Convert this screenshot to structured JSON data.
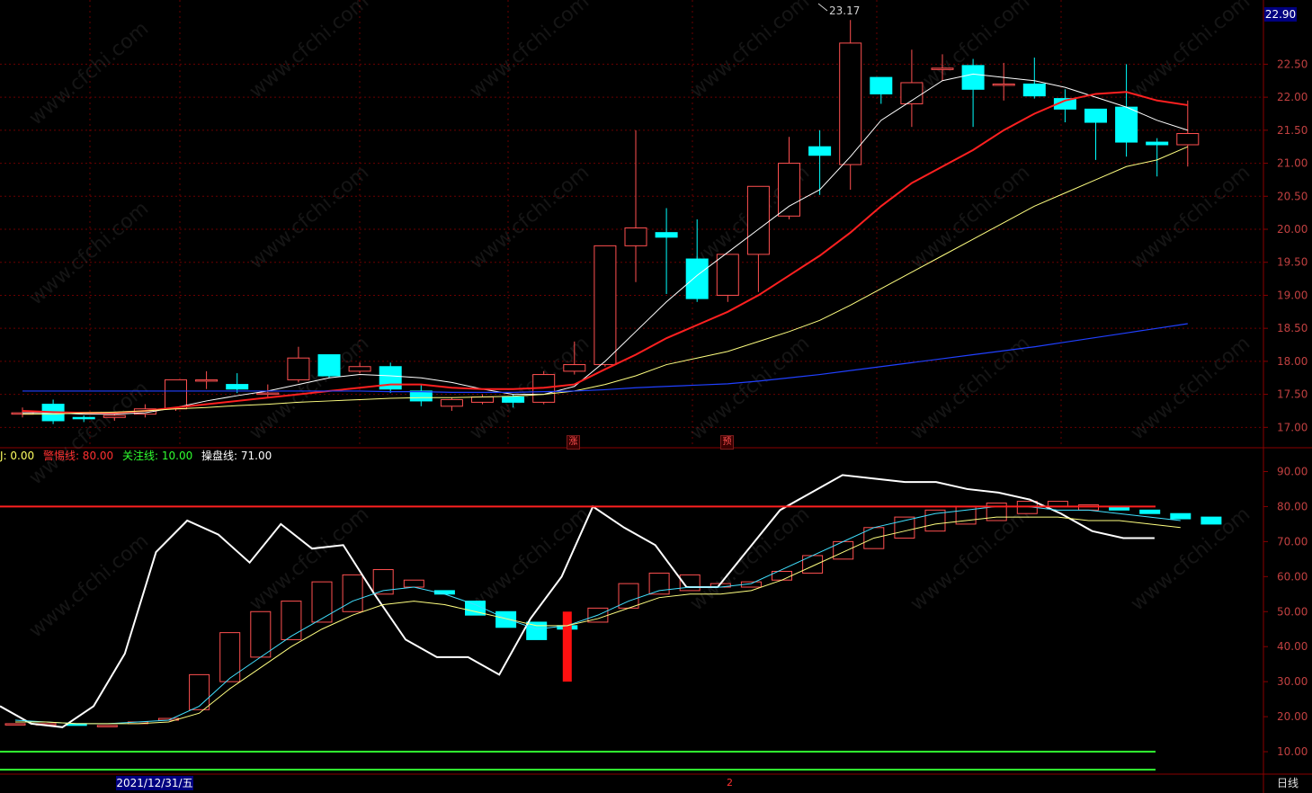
{
  "app": {
    "period_label": "日线",
    "cursor_date": "2021/12/31/五",
    "x_axis_marker": "2",
    "current_price": "22.90",
    "high_marker": "23.17",
    "watermark": "www.cfchi.com",
    "colors": {
      "background": "#000000",
      "up": "#ff5050",
      "down": "#00ffff",
      "ma5": "#ffffff",
      "ma10": "#ff2020",
      "ma20": "#ffff80",
      "ma60": "#2040ff",
      "grid": "#6a0000"
    }
  },
  "price_panel": {
    "y_ticks": [
      "22.50",
      "22.00",
      "21.50",
      "21.00",
      "20.50",
      "20.00",
      "19.50",
      "19.00",
      "18.50",
      "18.00",
      "17.50",
      "17.00"
    ],
    "tags": [
      {
        "text": "涨"
      },
      {
        "text": "预"
      }
    ]
  },
  "indicator_panel": {
    "legend": [
      {
        "label": "J: 0.00",
        "color": "#ffffff"
      },
      {
        "label": "警惕线: 80.00",
        "color": "#ff3030"
      },
      {
        "label": "关注线: 10.00",
        "color": "#30ff30"
      },
      {
        "label": "操盘线: 71.00",
        "color": "#ffffff"
      }
    ],
    "y_ticks": [
      "90.00",
      "80.00",
      "70.00",
      "60.00",
      "50.00",
      "40.00",
      "30.00",
      "20.00",
      "10.00"
    ]
  },
  "chart_data": [
    {
      "type": "candlestick",
      "ylim": [
        16.8,
        23.2
      ],
      "candles": [
        [
          17.22,
          17.22,
          17.3,
          17.15
        ],
        [
          17.35,
          17.1,
          17.42,
          17.05
        ],
        [
          17.15,
          17.13,
          17.18,
          17.08
        ],
        [
          17.15,
          17.18,
          17.22,
          17.1
        ],
        [
          17.2,
          17.28,
          17.35,
          17.15
        ],
        [
          17.28,
          17.72,
          17.72,
          17.25
        ],
        [
          17.72,
          17.72,
          17.85,
          17.58
        ],
        [
          17.65,
          17.58,
          17.82,
          17.52
        ],
        [
          17.52,
          17.52,
          17.65,
          17.45
        ],
        [
          17.72,
          18.05,
          18.22,
          17.68
        ],
        [
          18.1,
          17.78,
          18.1,
          17.75
        ],
        [
          17.85,
          17.92,
          17.98,
          17.82
        ],
        [
          17.92,
          17.58,
          17.98,
          17.52
        ],
        [
          17.55,
          17.4,
          17.65,
          17.32
        ],
        [
          17.32,
          17.42,
          17.45,
          17.25
        ],
        [
          17.38,
          17.46,
          17.5,
          17.35
        ],
        [
          17.46,
          17.38,
          17.5,
          17.3
        ],
        [
          17.38,
          17.8,
          17.85,
          17.35
        ],
        [
          17.85,
          17.95,
          18.3,
          17.8
        ],
        [
          17.95,
          19.75,
          19.75,
          17.92
        ],
        [
          19.75,
          20.02,
          21.5,
          19.2
        ],
        [
          19.95,
          19.88,
          20.32,
          19.02
        ],
        [
          19.55,
          18.95,
          20.15,
          18.9
        ],
        [
          19.0,
          19.62,
          19.62,
          18.9
        ],
        [
          19.62,
          20.65,
          20.65,
          19.05
        ],
        [
          20.2,
          21.0,
          21.4,
          20.15
        ],
        [
          21.25,
          21.12,
          21.5,
          20.52
        ],
        [
          20.98,
          22.82,
          23.17,
          20.6
        ],
        [
          22.3,
          22.05,
          22.3,
          21.9
        ],
        [
          21.9,
          22.22,
          22.72,
          21.55
        ],
        [
          22.42,
          22.44,
          22.65,
          22.25
        ],
        [
          22.48,
          22.12,
          22.58,
          21.55
        ],
        [
          22.18,
          22.2,
          22.52,
          21.95
        ],
        [
          22.2,
          22.02,
          22.6,
          21.98
        ],
        [
          21.98,
          21.82,
          22.12,
          21.62
        ],
        [
          21.82,
          21.62,
          21.75,
          21.05
        ],
        [
          21.85,
          21.32,
          22.5,
          21.1
        ],
        [
          21.32,
          21.28,
          21.38,
          20.8
        ],
        [
          21.28,
          21.45,
          21.95,
          20.95
        ]
      ],
      "series": [
        {
          "key": "ma5",
          "values": [
            17.22,
            17.22,
            17.2,
            17.2,
            17.22,
            17.3,
            17.4,
            17.48,
            17.55,
            17.65,
            17.75,
            17.8,
            17.78,
            17.75,
            17.68,
            17.58,
            17.5,
            17.5,
            17.62,
            18.0,
            18.45,
            18.9,
            19.3,
            19.65,
            20.0,
            20.35,
            20.6,
            21.1,
            21.65,
            21.95,
            22.25,
            22.35,
            22.3,
            22.25,
            22.15,
            22.0,
            21.85,
            21.65,
            21.5
          ]
        },
        {
          "key": "ma10",
          "values": [
            17.25,
            17.23,
            17.22,
            17.22,
            17.25,
            17.3,
            17.35,
            17.4,
            17.45,
            17.5,
            17.55,
            17.6,
            17.65,
            17.65,
            17.6,
            17.58,
            17.58,
            17.6,
            17.65,
            17.88,
            18.1,
            18.35,
            18.55,
            18.75,
            19.0,
            19.3,
            19.6,
            19.95,
            20.35,
            20.7,
            20.95,
            21.2,
            21.5,
            21.75,
            21.95,
            22.05,
            22.08,
            21.95,
            21.88
          ]
        },
        {
          "key": "ma20",
          "values": [
            17.2,
            17.2,
            17.22,
            17.23,
            17.25,
            17.28,
            17.3,
            17.33,
            17.35,
            17.38,
            17.4,
            17.42,
            17.44,
            17.45,
            17.45,
            17.46,
            17.47,
            17.5,
            17.55,
            17.65,
            17.78,
            17.95,
            18.05,
            18.15,
            18.3,
            18.45,
            18.62,
            18.85,
            19.1,
            19.35,
            19.6,
            19.85,
            20.1,
            20.35,
            20.55,
            20.75,
            20.95,
            21.05,
            21.25
          ]
        },
        {
          "key": "ma60",
          "values": [
            17.55,
            17.55,
            17.55,
            17.55,
            17.55,
            17.55,
            17.55,
            17.55,
            17.55,
            17.55,
            17.55,
            17.55,
            17.54,
            17.54,
            17.53,
            17.53,
            17.53,
            17.54,
            17.55,
            17.57,
            17.6,
            17.62,
            17.64,
            17.66,
            17.7,
            17.75,
            17.8,
            17.86,
            17.92,
            17.98,
            18.04,
            18.1,
            18.16,
            18.22,
            18.29,
            18.36,
            18.43,
            18.5,
            18.57
          ]
        }
      ]
    },
    {
      "type": "candlestick",
      "ylim": [
        0,
        95
      ],
      "candles": [
        [
          18,
          18,
          18.5,
          17.5
        ],
        [
          18,
          18,
          18.5,
          17.5
        ],
        [
          18,
          17.5,
          18.5,
          17
        ],
        [
          17.5,
          17.5,
          18,
          17
        ],
        [
          18,
          18.5,
          19,
          17.5
        ],
        [
          19,
          19.5,
          20,
          18.5
        ],
        [
          22,
          32,
          32.5,
          21.5
        ],
        [
          30,
          44,
          44.5,
          29.5
        ],
        [
          37,
          50,
          50.5,
          36.5
        ],
        [
          42,
          53,
          53.5,
          41.5
        ],
        [
          47,
          58.5,
          59,
          46.5
        ],
        [
          50,
          60.5,
          61,
          49.5
        ],
        [
          55,
          62,
          62.5,
          54.5
        ],
        [
          57,
          59,
          59.5,
          56.5
        ],
        [
          56,
          55,
          56,
          54.5
        ],
        [
          53,
          49,
          53,
          48.5
        ],
        [
          50,
          45.5,
          50,
          45
        ],
        [
          47,
          42,
          47,
          41.5
        ],
        [
          46,
          45,
          46,
          44.5
        ],
        [
          47,
          51,
          51.5,
          46.5
        ],
        [
          51,
          58,
          58.5,
          50.5
        ],
        [
          55,
          61,
          61.5,
          54.5
        ],
        [
          56,
          60.5,
          61,
          55.5
        ],
        [
          57,
          58,
          58.5,
          56.5
        ],
        [
          57,
          58.5,
          59,
          56.5
        ],
        [
          59,
          61.5,
          62,
          58.5
        ],
        [
          61,
          66,
          66.5,
          60.5
        ],
        [
          65,
          70,
          70.5,
          64.5
        ],
        [
          68,
          74,
          74.5,
          67.5
        ],
        [
          71,
          77,
          77.5,
          70.5
        ],
        [
          73,
          79,
          79.5,
          72.5
        ],
        [
          75,
          80,
          80.5,
          74.5
        ],
        [
          76,
          81,
          81.5,
          75.5
        ],
        [
          78,
          81.5,
          82,
          77.5
        ],
        [
          80,
          81.5,
          82,
          79.5
        ],
        [
          79,
          80.5,
          81,
          78.5
        ],
        [
          80,
          79,
          80,
          78.5
        ],
        [
          79,
          78,
          79,
          77.5
        ],
        [
          78,
          76.5,
          78,
          76
        ],
        [
          77,
          75,
          77,
          74.5
        ]
      ],
      "series": [
        {
          "key": "cao_pan_xian",
          "values": [
            23,
            18,
            17,
            23,
            38,
            67,
            76,
            72,
            64,
            75,
            68,
            69,
            55,
            42,
            37,
            37,
            32,
            48,
            60,
            80,
            74,
            69,
            57,
            57,
            68,
            79,
            84,
            89,
            88,
            87,
            87,
            85,
            84,
            82,
            78,
            73,
            71,
            71
          ]
        },
        {
          "key": "k_line",
          "values": [
            19,
            18.5,
            18,
            18,
            18.5,
            19,
            23,
            31,
            37,
            43,
            48,
            53,
            56,
            57,
            55,
            52,
            48,
            45,
            46,
            49,
            53,
            56,
            57,
            57,
            58,
            62,
            66,
            70,
            74,
            76,
            78,
            79,
            80,
            80,
            79,
            79,
            78,
            77,
            76
          ]
        },
        {
          "key": "d_line",
          "values": [
            18.5,
            18.5,
            18,
            18,
            18,
            18.5,
            21,
            28,
            34,
            40,
            45,
            49,
            52,
            53,
            52,
            50,
            48,
            46,
            46,
            48,
            51,
            54,
            55,
            55,
            56,
            59,
            63,
            67,
            71,
            73,
            75,
            76,
            77,
            77,
            77,
            76,
            76,
            75,
            74
          ]
        },
        {
          "key": "warning_line",
          "values": [
            80
          ]
        },
        {
          "key": "watch_line",
          "values": [
            10
          ]
        },
        {
          "key": "bottom_line",
          "values": [
            0
          ]
        }
      ],
      "signal_bars": [
        {
          "index": 18,
          "from": 30,
          "to": 50
        }
      ]
    }
  ]
}
